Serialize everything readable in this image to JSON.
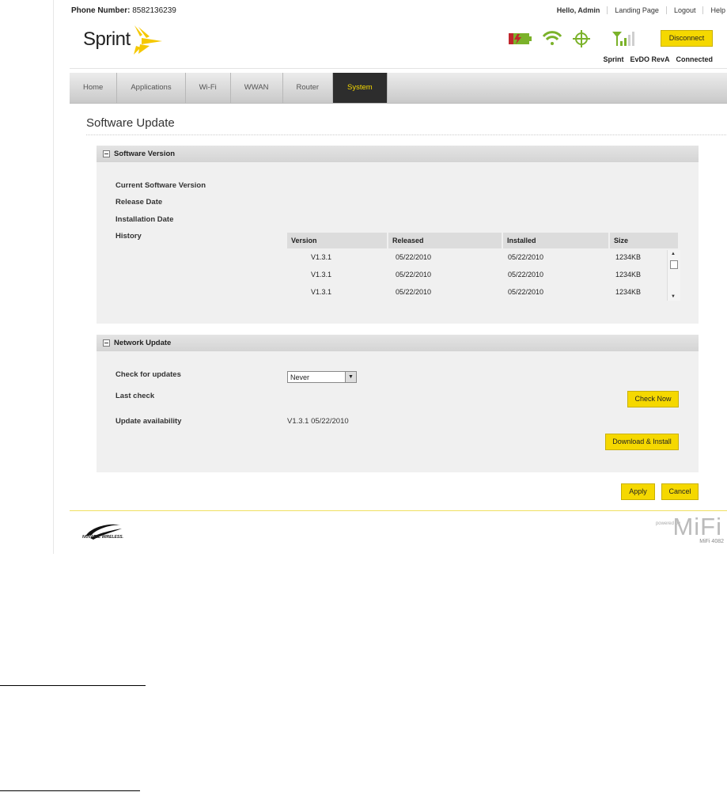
{
  "header": {
    "phone_label": "Phone Number:",
    "phone_number": "8582136239",
    "greeting": "Hello, Admin",
    "landing_page": "Landing Page",
    "logout": "Logout",
    "help": "Help",
    "brand": "Sprint",
    "disconnect_label": "Disconnect",
    "status": {
      "carrier": "Sprint",
      "technology": "EvDO RevA",
      "connection": "Connected"
    }
  },
  "nav": {
    "items": [
      "Home",
      "Applications",
      "Wi-Fi",
      "WWAN",
      "Router",
      "System"
    ],
    "active": "System"
  },
  "page_title": "Software Update",
  "software_version": {
    "title": "Software Version",
    "current_label": "Current Software Version",
    "release_label": "Release Date",
    "install_label": "Installation Date",
    "history_label": "History",
    "columns": [
      "Version",
      "Released",
      "Installed",
      "Size"
    ],
    "rows": [
      [
        "V1.3.1",
        "05/22/2010",
        "05/22/2010",
        "1234KB"
      ],
      [
        "V1.3.1",
        "05/22/2010",
        "05/22/2010",
        "1234KB"
      ],
      [
        "V1.3.1",
        "05/22/2010",
        "05/22/2010",
        "1234KB"
      ]
    ]
  },
  "network_update": {
    "title": "Network Update",
    "check_label": "Check for updates",
    "check_value": "Never",
    "last_check_label": "Last check",
    "check_now": "Check Now",
    "availability_label": "Update availability",
    "availability_value": "V1.3.1 05/22/2010",
    "download_install": "Download & Install"
  },
  "actions": {
    "apply": "Apply",
    "cancel": "Cancel"
  },
  "footer": {
    "novatel": "NOVATEL WIRELESS.",
    "powered_by": "powered by",
    "mifi": "MiFi",
    "model": "MiFi 4082"
  },
  "colors": {
    "accent_yellow": "#f5d800",
    "nav_active_bg": "#2d2d2d",
    "battery_green": "#7bb22a",
    "battery_red": "#c0272d"
  }
}
